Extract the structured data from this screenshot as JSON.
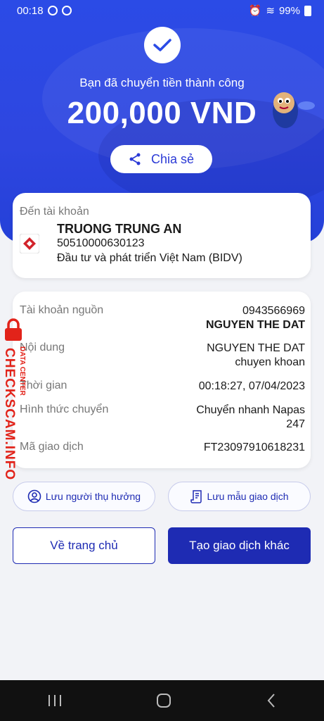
{
  "status_bar": {
    "time": "00:18",
    "battery": "99%"
  },
  "header": {
    "success_message": "Bạn đã chuyển tiền thành công",
    "amount": "200,000 VND",
    "share_label": "Chia sẻ"
  },
  "recipient": {
    "label": "Đến tài khoản",
    "name": "TRUONG TRUNG AN",
    "account": "50510000630123",
    "bank": "Đầu tư và phát triển Việt Nam (BIDV)"
  },
  "details": {
    "source_label": "Tài khoản nguồn",
    "source_account": "0943566969",
    "source_name": "NGUYEN THE DAT",
    "content_label": "Nội dung",
    "content_line1": "NGUYEN THE DAT",
    "content_line2": "chuyen khoan",
    "time_label": "Thời gian",
    "time_value": "00:18:27, 07/04/2023",
    "method_label": "Hình thức chuyển",
    "method_line1": "Chuyển nhanh Napas",
    "method_line2": "247",
    "txn_label": "Mã giao dịch",
    "txn_value": "FT23097910618231"
  },
  "actions": {
    "save_beneficiary": "Lưu người thụ hưởng",
    "save_template": "Lưu mẫu giao dịch",
    "home": "Về trang chủ",
    "new_transaction": "Tạo giao dịch khác"
  },
  "watermark": {
    "text": "CHECKSCAM.INFO",
    "sub": "DATA CENTER"
  },
  "colors": {
    "primary": "#1e2bb3",
    "hero": "#2b4be6",
    "watermark": "#e2231a"
  }
}
